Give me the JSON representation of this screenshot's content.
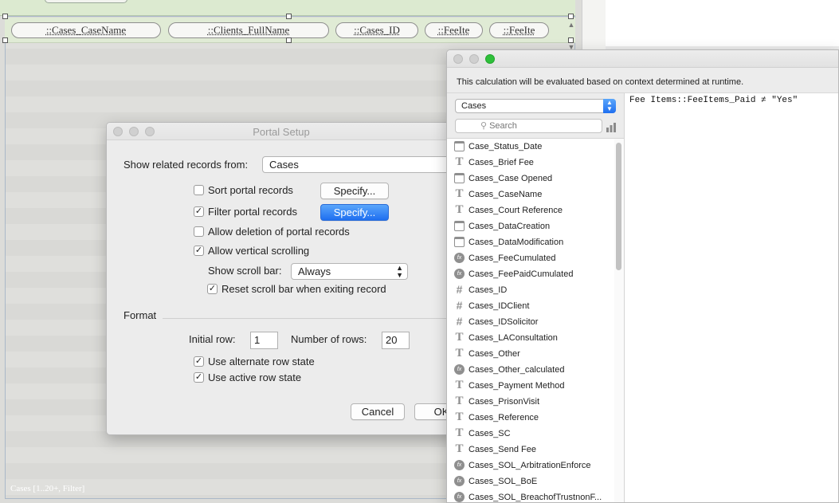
{
  "layout": {
    "portal_fields": [
      {
        "label": "::Cases_CaseName"
      },
      {
        "label": "::Clients_FullName"
      },
      {
        "label": "::Cases_ID"
      },
      {
        "label": "::FeeIte"
      },
      {
        "label": "::FeeIte"
      }
    ],
    "portal_label": "Cases [1..20+, Filter]"
  },
  "portal_setup": {
    "title": "Portal Setup",
    "show_related_label": "Show related records from:",
    "related_table": "Cases",
    "sort": {
      "label": "Sort portal records",
      "checked": false,
      "button": "Specify..."
    },
    "filter": {
      "label": "Filter portal records",
      "checked": true,
      "button": "Specify..."
    },
    "allow_deletion": {
      "label": "Allow deletion of portal records",
      "checked": false
    },
    "allow_scroll": {
      "label": "Allow vertical scrolling",
      "checked": true
    },
    "show_scroll_bar_label": "Show scroll bar:",
    "scroll_bar_value": "Always",
    "reset_scroll": {
      "label": "Reset scroll bar when exiting record",
      "checked": true
    },
    "format_label": "Format",
    "initial_row_label": "Initial row:",
    "initial_row_value": "1",
    "num_rows_label": "Number of rows:",
    "num_rows_value": "20",
    "alt_row": {
      "label": "Use alternate row state",
      "checked": true
    },
    "active_row": {
      "label": "Use active row state",
      "checked": true
    },
    "cancel_label": "Cancel",
    "ok_label": "OK"
  },
  "calc_dialog": {
    "context_text": "This calculation will be evaluated based on context determined at runtime.",
    "table_selected": "Cases",
    "search_placeholder": "Search",
    "formula": "Fee Items::FeeItems_Paid ≠ \"Yes\"",
    "fields": [
      {
        "name": "Case_Status_Date",
        "type": "date"
      },
      {
        "name": "Cases_Brief Fee",
        "type": "text"
      },
      {
        "name": "Cases_Case Opened",
        "type": "date"
      },
      {
        "name": "Cases_CaseName",
        "type": "text"
      },
      {
        "name": "Cases_Court Reference",
        "type": "text"
      },
      {
        "name": "Cases_DataCreation",
        "type": "date"
      },
      {
        "name": "Cases_DataModification",
        "type": "date"
      },
      {
        "name": "Cases_FeeCumulated",
        "type": "calc"
      },
      {
        "name": "Cases_FeePaidCumulated",
        "type": "calc"
      },
      {
        "name": "Cases_ID",
        "type": "number"
      },
      {
        "name": "Cases_IDClient",
        "type": "number"
      },
      {
        "name": "Cases_IDSolicitor",
        "type": "number"
      },
      {
        "name": "Cases_LAConsultation",
        "type": "text"
      },
      {
        "name": "Cases_Other",
        "type": "text"
      },
      {
        "name": "Cases_Other_calculated",
        "type": "calc"
      },
      {
        "name": "Cases_Payment Method",
        "type": "text"
      },
      {
        "name": "Cases_PrisonVisit",
        "type": "text"
      },
      {
        "name": "Cases_Reference",
        "type": "text"
      },
      {
        "name": "Cases_SC",
        "type": "text"
      },
      {
        "name": "Cases_Send Fee",
        "type": "text"
      },
      {
        "name": "Cases_SOL_ArbitrationEnforce",
        "type": "calc"
      },
      {
        "name": "Cases_SOL_BoE",
        "type": "calc"
      },
      {
        "name": "Cases_SOL_BreachofTrustnonF...",
        "type": "calc"
      }
    ]
  },
  "colors": {
    "accent_blue": "#1f6ff0",
    "traffic_green": "#2ec03a",
    "header_green": "#dcead0"
  },
  "icons": {
    "text_field": "T",
    "number_field": "#",
    "calc_field": "fx",
    "date_field": "calendar"
  }
}
